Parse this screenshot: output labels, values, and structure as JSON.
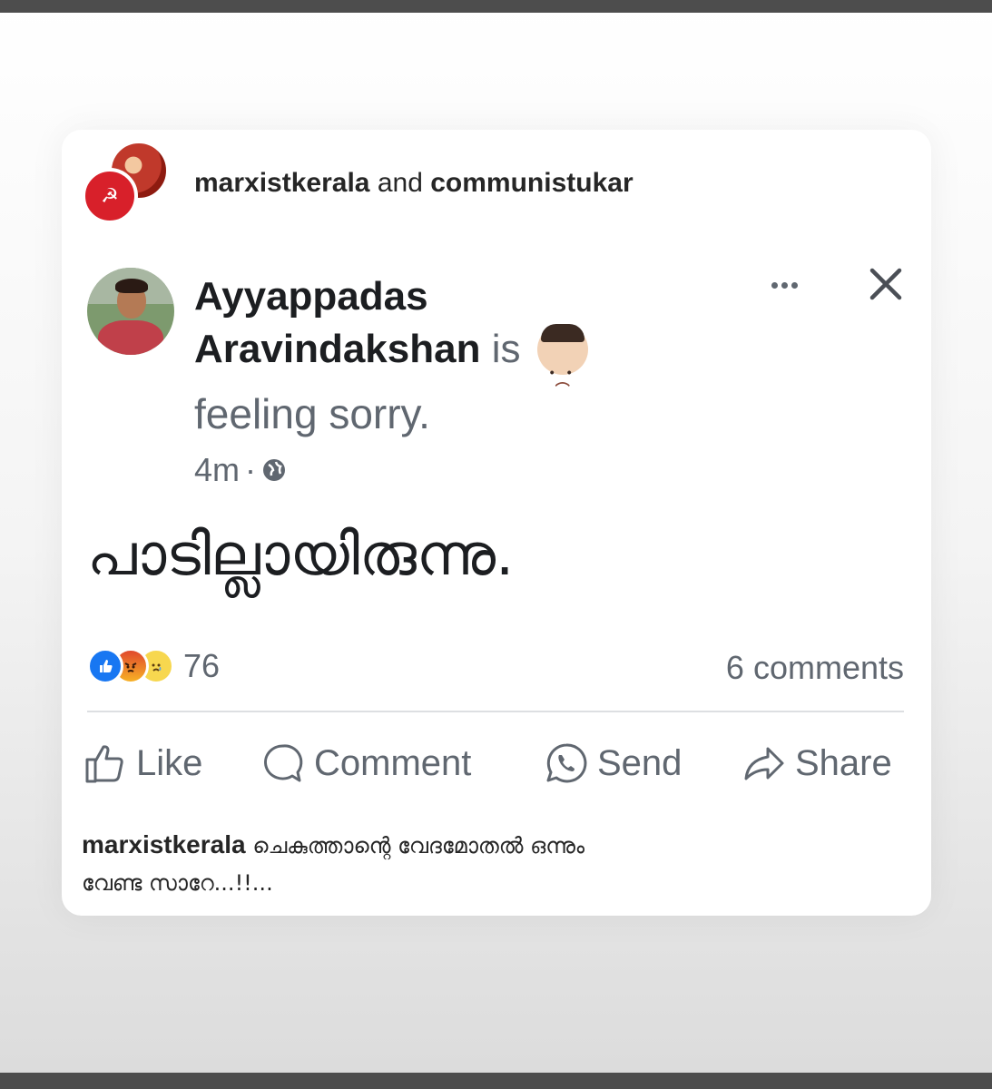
{
  "collab": {
    "account1": "marxistkerala",
    "joiner": "and",
    "account2": "communistukar"
  },
  "post": {
    "author_first": "Ayyappadas",
    "author_last": "Aravindakshan",
    "is_word": "is",
    "feeling": "feeling sorry.",
    "time": "4m",
    "dot": "·",
    "text": "പാടില്ലായിരുന്നു.",
    "reaction_count": "76",
    "comments": "6 comments"
  },
  "actions": {
    "like": "Like",
    "comment": "Comment",
    "send": "Send",
    "share": "Share"
  },
  "caption": {
    "username": "marxistkerala",
    "line1": "ചെകുത്താന്റെ വേദമോതൽ ഒന്നും",
    "line2": "വേണ്ട സാറേ...!!..."
  },
  "icons": {
    "party_symbol": "☭"
  },
  "colors": {
    "like_blue": "#1877f2",
    "party_red": "#d8202a",
    "text_gray": "#606770"
  }
}
